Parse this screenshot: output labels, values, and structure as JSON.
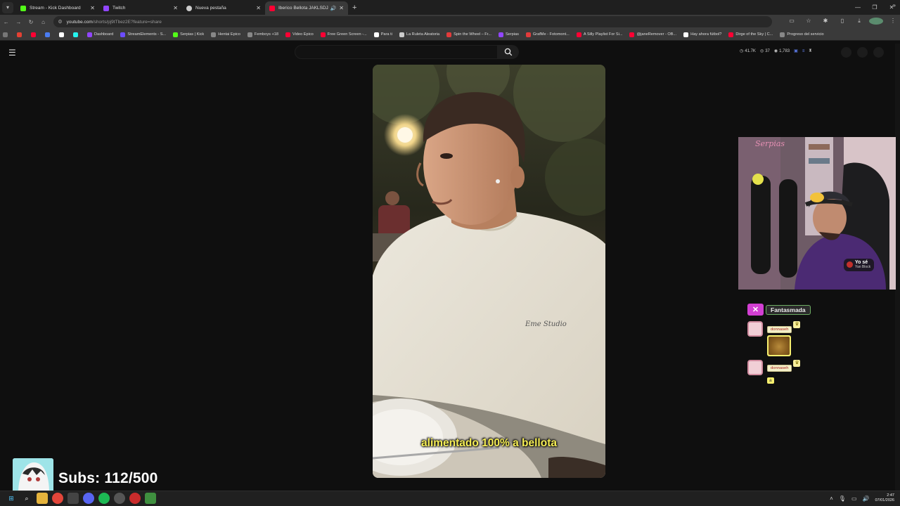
{
  "browser": {
    "tabs": [
      {
        "label": "Stream - Kick Dashboard",
        "fav_color": "#53fc18",
        "active": false
      },
      {
        "label": "Twitch",
        "fav_color": "#9146ff",
        "active": false
      },
      {
        "label": "Nueva pestaña",
        "fav_color": "#cccccc",
        "active": false
      },
      {
        "label": "Iberico Bellota JAKLSDJA -",
        "fav_color": "#ff0033",
        "active": true
      }
    ],
    "url_host": "youtube.com",
    "url_path": "/shorts/pj9tTbez2E?feature=share",
    "bookmarks": [
      {
        "label": "Dashboard",
        "color": "#9146ff"
      },
      {
        "label": "StreamElements - S...",
        "color": "#6c4cff"
      },
      {
        "label": "Serpias | Kick",
        "color": "#53fc18"
      },
      {
        "label": "Hentai Epico",
        "color": "#888888"
      },
      {
        "label": "Femboys +18",
        "color": "#888888"
      },
      {
        "label": "Video Epico",
        "color": "#ff0033"
      },
      {
        "label": "Free Green Screen -...",
        "color": "#ff0033"
      },
      {
        "label": "Para ti",
        "color": "#ffffff"
      },
      {
        "label": "La Ruleta Aleatoria",
        "color": "#cccccc"
      },
      {
        "label": "Spin the Wheel – Fr...",
        "color": "#e23b3b"
      },
      {
        "label": "Serpias",
        "color": "#9146ff"
      },
      {
        "label": "GrafMe - Fotomont...",
        "color": "#e23b3b"
      },
      {
        "label": "A Silly Playlist For Si...",
        "color": "#ff0033"
      },
      {
        "label": "@janeRemover - OB...",
        "color": "#ff0033"
      },
      {
        "label": "Hay ahora fútbol?",
        "color": "#ffffff"
      },
      {
        "label": "Dirge of the Sky | C...",
        "color": "#ff0033"
      },
      {
        "label": "Progreso del servicio",
        "color": "#888888"
      }
    ]
  },
  "youtube": {
    "stats": {
      "views": "41.7K",
      "likes": "37",
      "comments": "1,783"
    }
  },
  "video": {
    "caption": "alimentado 100% a bellota",
    "shirt_text": "Eme Studio"
  },
  "webcam": {
    "brand": "Serpias",
    "sticker_title": "Yo sé",
    "sticker_sub": "Yan Block"
  },
  "chat": {
    "header_name": "Fantasmada",
    "messages": [
      {
        "user": "donnaseh",
        "type": "emote"
      },
      {
        "user": "donnaseh",
        "text": "a"
      }
    ]
  },
  "subs": {
    "text": "Subs: 112/500"
  },
  "taskbar": {
    "time": "2:47",
    "date": "07/01/2026"
  },
  "colors": {
    "accent_kick": "#53fc18",
    "caption_yellow": "#f6ee55",
    "chat_x": "#d23fd2"
  }
}
